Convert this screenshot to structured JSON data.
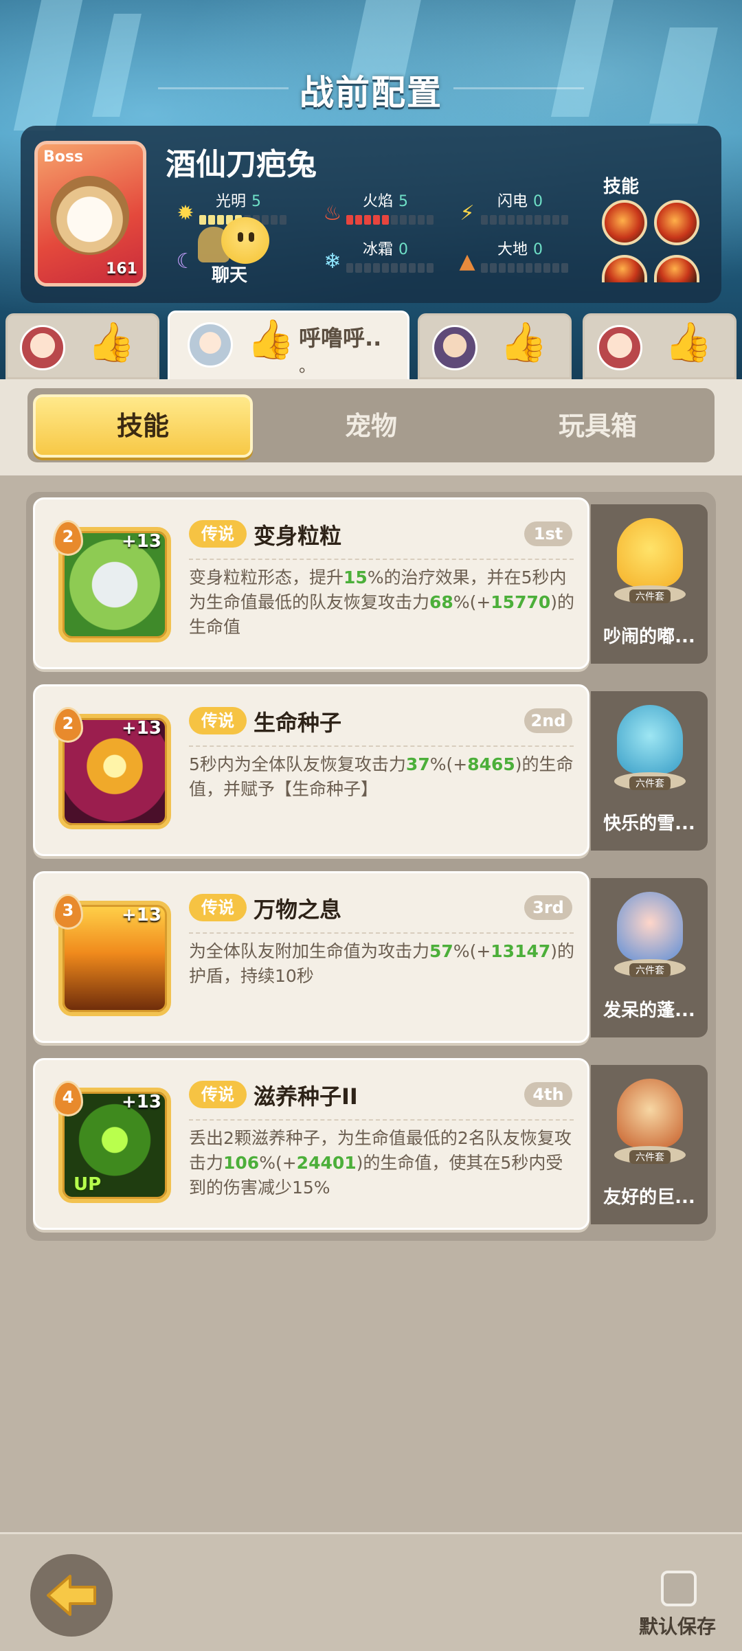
{
  "header": {
    "title": "战前配置"
  },
  "boss": {
    "tag": "Boss",
    "name": "酒仙刀疤兔",
    "level": "161",
    "skills_label": "技能",
    "elements": [
      {
        "label": "光明",
        "value": "5",
        "icon": "sun-icon",
        "filled": 5
      },
      {
        "label": "火焰",
        "value": "5",
        "icon": "flame-icon",
        "filled": 5
      },
      {
        "label": "闪电",
        "value": "0",
        "icon": "lightning-icon",
        "filled": 0
      },
      {
        "label": "冰霜",
        "value": "0",
        "icon": "snowflake-icon",
        "filled": 0
      },
      {
        "label": "大地",
        "value": "0",
        "icon": "earth-icon",
        "filled": 0
      }
    ],
    "dark_icon": "moon-icon"
  },
  "chat": {
    "label": "聊天"
  },
  "players": [
    {
      "name": ""
    },
    {
      "name": "呼噜呼..",
      "extra": "。"
    },
    {
      "name": ""
    },
    {
      "name": ""
    }
  ],
  "tabs": [
    {
      "label": "技能",
      "active": true
    },
    {
      "label": "宠物",
      "active": false
    },
    {
      "label": "玩具箱",
      "active": false
    }
  ],
  "skills": [
    {
      "level": "2",
      "plus": "+13",
      "rarity": "传说",
      "name": "变身粒粒",
      "rank": "1st",
      "desc": [
        {
          "t": "变身粒粒形态，提升"
        },
        {
          "t": "15",
          "hl": true
        },
        {
          "t": "%的治疗效果，并在5秒内为生命值最低的队友恢复攻击力"
        },
        {
          "t": "68",
          "hl": true
        },
        {
          "t": "%(+"
        },
        {
          "t": "15770",
          "hl": true
        },
        {
          "t": ")的生命值"
        }
      ],
      "pet": {
        "name": "吵闹的嘟...",
        "set": "六件套"
      }
    },
    {
      "level": "2",
      "plus": "+13",
      "rarity": "传说",
      "name": "生命种子",
      "rank": "2nd",
      "desc": [
        {
          "t": "5秒内为全体队友恢复攻击力"
        },
        {
          "t": "37",
          "hl": true
        },
        {
          "t": "%(+"
        },
        {
          "t": "8465",
          "hl": true
        },
        {
          "t": ")的生命值，并赋予【生命种子】"
        }
      ],
      "pet": {
        "name": "快乐的雪...",
        "set": "六件套"
      }
    },
    {
      "level": "3",
      "plus": "+13",
      "rarity": "传说",
      "name": "万物之息",
      "rank": "3rd",
      "desc": [
        {
          "t": "为全体队友附加生命值为攻击力"
        },
        {
          "t": "57",
          "hl": true
        },
        {
          "t": "%(+"
        },
        {
          "t": "13147",
          "hl": true
        },
        {
          "t": ")的护盾，持续10秒"
        }
      ],
      "pet": {
        "name": "发呆的蓬...",
        "set": "六件套"
      }
    },
    {
      "level": "4",
      "plus": "+13",
      "rarity": "传说",
      "name": "滋养种子II",
      "rank": "4th",
      "up": "UP",
      "desc": [
        {
          "t": "丢出2颗滋养种子，为生命值最低的2名队友恢复攻击力"
        },
        {
          "t": "106",
          "hl": true
        },
        {
          "t": "%(+"
        },
        {
          "t": "24401",
          "hl": true
        },
        {
          "t": ")的生命值，使其在5秒内受到的伤害减少15%"
        }
      ],
      "pet": {
        "name": "友好的巨...",
        "set": "六件套"
      }
    }
  ],
  "footer": {
    "save_label": "默认保存",
    "save_checked": false
  },
  "colors": {
    "accent": "#f7c846",
    "highlight": "#4caf3a",
    "rarity": "#f6c343"
  }
}
